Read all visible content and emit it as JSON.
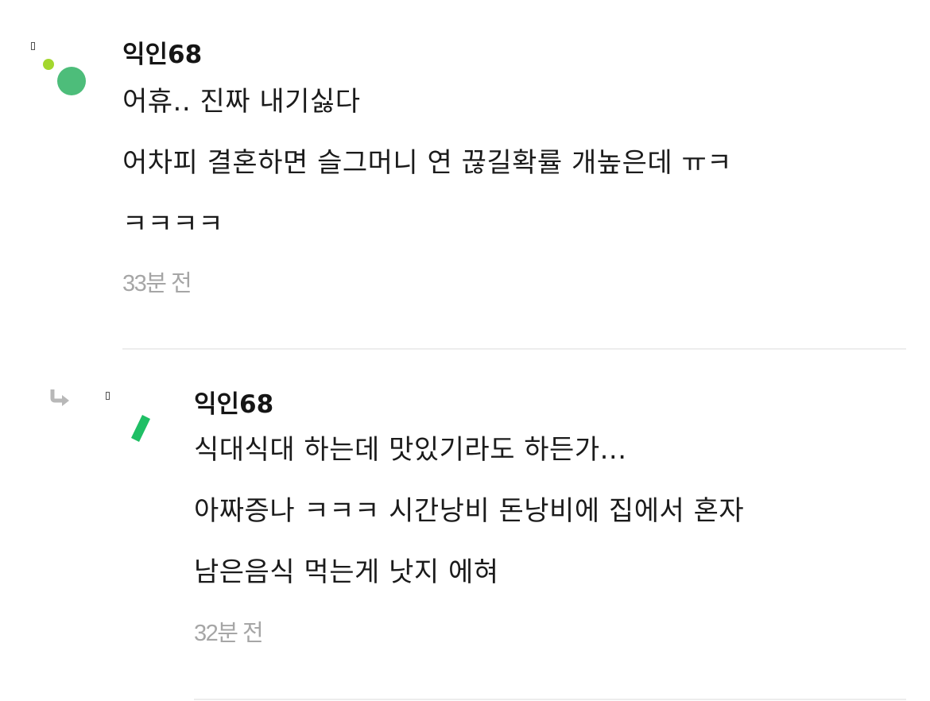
{
  "comments": [
    {
      "author": "익인68",
      "lines": [
        "어휴.. 진짜 내기싫다",
        "어차피 결혼하면 슬그머니 연 끊길확률 개높은데 ㅠㅋ",
        "ㅋㅋㅋㅋ"
      ],
      "time": "33분 전",
      "is_reply": false
    },
    {
      "author": "익인68",
      "lines": [
        "식대식대 하는데 맛있기라도 하든가...",
        "아짜증나 ㅋㅋㅋ 시간낭비 돈낭비에 집에서 혼자",
        "남은음식 먹는게 낫지 에혀"
      ],
      "time": "32분 전",
      "is_reply": true
    }
  ],
  "colors": {
    "avatar_dot_light": "#a3d72e",
    "avatar_dot_dark": "#4dbd7a",
    "avatar_bar": "#1fbf65",
    "timestamp": "#a6a6a6",
    "divider": "#ededed"
  },
  "icons": {
    "reply": "reply-arrow-icon",
    "avatar_1": "avatar-dots-icon",
    "avatar_2": "avatar-slash-icon"
  }
}
